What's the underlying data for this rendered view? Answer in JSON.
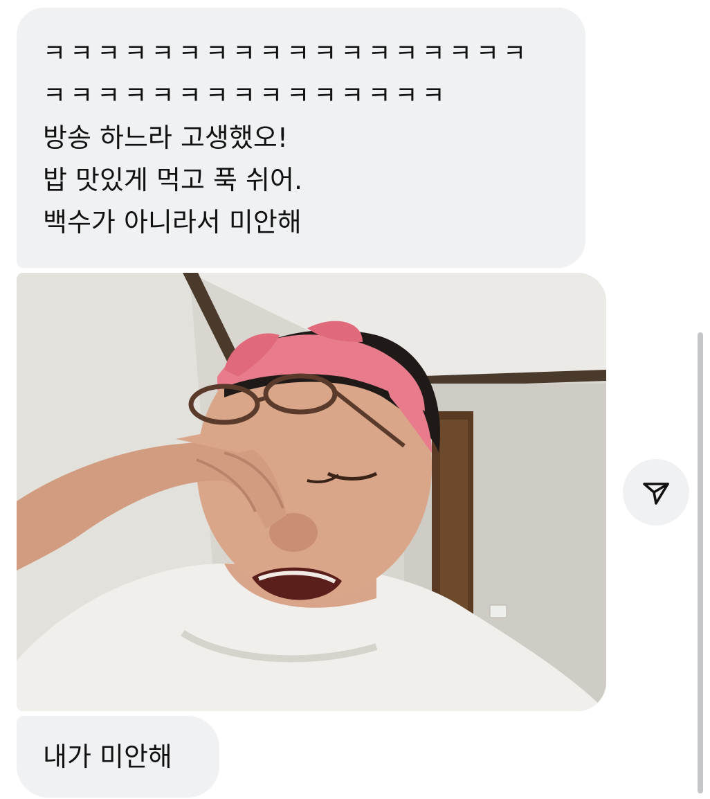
{
  "messages": {
    "first": {
      "lines": [
        "ㅋㅋㅋㅋㅋㅋㅋㅋㅋㅋㅋㅋㅋㅋㅋㅋㅋㅋ",
        "ㅋㅋㅋㅋㅋㅋㅋㅋㅋㅋㅋㅋㅋㅋㅋ",
        "방송 하느라 고생했오!",
        "밥 맛있게 먹고 푹 쉬어.",
        "백수가 아니라서 미안해"
      ]
    },
    "image": {
      "description_icon": "crying-man-photo"
    },
    "second": {
      "text": "내가 미안해"
    }
  },
  "actions": {
    "share_icon": "paper-plane-icon"
  },
  "colors": {
    "bubble_background": "#eff1f3",
    "text": "#111111",
    "scrollbar": "#c4c6c9",
    "headband": "#e87c8c"
  }
}
